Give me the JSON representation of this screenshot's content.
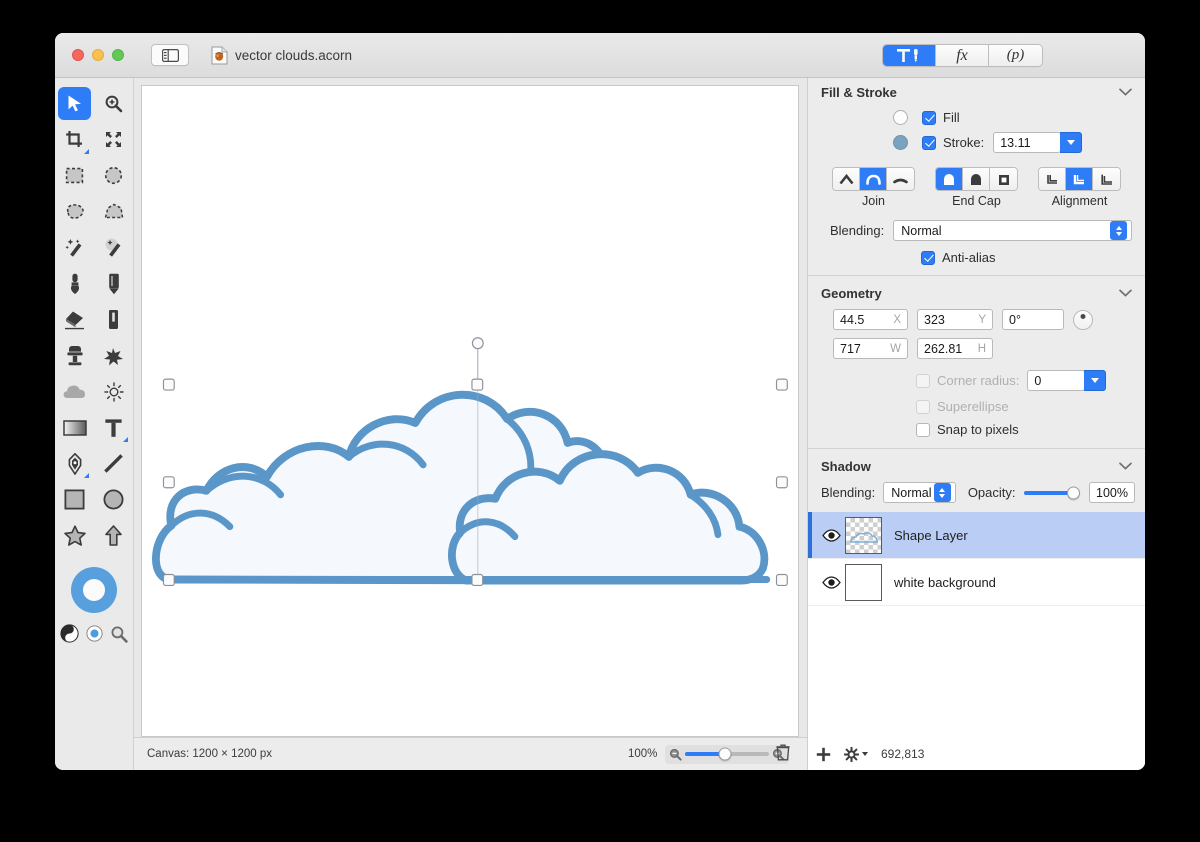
{
  "window": {
    "title": "vector clouds.acorn",
    "doc_icon": "acorn-document-icon",
    "sidebar_toggle_icon": "sidebar-toggle-icon"
  },
  "top_segmented": [
    {
      "id": "tools",
      "icon": "hammer-brush-icon",
      "label": "",
      "active": true
    },
    {
      "id": "filters",
      "label": "fx",
      "active": false
    },
    {
      "id": "presets",
      "label": "(p)",
      "active": false
    }
  ],
  "toolbar": {
    "tools": [
      {
        "name": "move-tool",
        "icon": "arrow-cursor-icon",
        "selected": true
      },
      {
        "name": "zoom-tool",
        "icon": "magnifier-plus-icon",
        "selected": false
      },
      {
        "name": "crop-tool",
        "icon": "crop-icon",
        "selected": false
      },
      {
        "name": "transform-tool",
        "icon": "transform-arrows-icon",
        "selected": false
      },
      {
        "name": "rectangular-select-tool",
        "icon": "marquee-rect-icon",
        "selected": false
      },
      {
        "name": "elliptical-select-tool",
        "icon": "marquee-ellipse-icon",
        "selected": false
      },
      {
        "name": "lasso-tool",
        "icon": "lasso-icon",
        "selected": false
      },
      {
        "name": "polygon-select-tool",
        "icon": "polygon-lasso-icon",
        "selected": false
      },
      {
        "name": "magic-wand-tool",
        "icon": "magic-wand-icon",
        "selected": false
      },
      {
        "name": "instant-alpha-tool",
        "icon": "magic-wand-dots-icon",
        "selected": false
      },
      {
        "name": "brush-tool",
        "icon": "paint-brush-icon",
        "selected": false
      },
      {
        "name": "pencil-tool",
        "icon": "pencil-icon",
        "selected": false
      },
      {
        "name": "eraser-tool",
        "icon": "eraser-icon",
        "selected": false
      },
      {
        "name": "marker-tool",
        "icon": "marker-icon",
        "selected": false
      },
      {
        "name": "clone-stamp-tool",
        "icon": "clone-stamp-icon",
        "selected": false
      },
      {
        "name": "smudge-tool",
        "icon": "smudge-splat-icon",
        "selected": false
      },
      {
        "name": "blur-tool",
        "icon": "cloud-blur-icon",
        "selected": false
      },
      {
        "name": "dodge-burn-tool",
        "icon": "sun-dodge-icon",
        "selected": false
      },
      {
        "name": "gradient-tool",
        "icon": "gradient-icon",
        "selected": false
      },
      {
        "name": "text-tool",
        "icon": "text-t-icon",
        "selected": false
      },
      {
        "name": "bezier-pen-tool",
        "icon": "pen-nib-icon",
        "selected": false
      },
      {
        "name": "line-tool",
        "icon": "line-icon",
        "selected": false
      },
      {
        "name": "rectangle-tool",
        "icon": "rectangle-icon",
        "selected": false
      },
      {
        "name": "ellipse-tool",
        "icon": "ellipse-icon",
        "selected": false
      },
      {
        "name": "star-tool",
        "icon": "star-icon",
        "selected": false
      },
      {
        "name": "arrow-shape-tool",
        "icon": "arrow-up-shape-icon",
        "selected": false
      }
    ],
    "color_well": {
      "name": "stroke-color-well",
      "color": "#57a0dd",
      "inner": "#fbfbfb"
    },
    "bottom_icons": [
      {
        "name": "default-colors-icon",
        "icon": "yin-yang-icon"
      },
      {
        "name": "color-picker-icon",
        "icon": "target-circle-icon"
      },
      {
        "name": "loupe-icon",
        "icon": "magnifier-icon"
      }
    ]
  },
  "inspector": {
    "fill_stroke": {
      "title": "Fill & Stroke",
      "collapse_icon": "chevron-down-icon",
      "fill": {
        "label": "Fill",
        "checked": true,
        "swatch_color": "#fdfdfd"
      },
      "stroke": {
        "label": "Stroke:",
        "checked": true,
        "swatch_color": "#7ba3bf",
        "width": "13.11"
      },
      "join": {
        "label": "Join",
        "options": [
          "miter-join-icon",
          "round-join-icon",
          "bevel-join-icon"
        ],
        "selected_index": 1
      },
      "end_cap": {
        "label": "End Cap",
        "options": [
          "round-cap-icon",
          "butt-cap-icon",
          "square-cap-icon"
        ],
        "selected_index": 0
      },
      "alignment": {
        "label": "Alignment",
        "options": [
          "align-inside-icon",
          "align-center-icon",
          "align-outside-icon"
        ],
        "selected_index": 1
      },
      "blending": {
        "label": "Blending:",
        "value": "Normal"
      },
      "anti_alias": {
        "label": "Anti-alias",
        "checked": true
      }
    },
    "geometry": {
      "title": "Geometry",
      "collapse_icon": "chevron-down-icon",
      "x": {
        "value": "44.5",
        "suffix": "X"
      },
      "y": {
        "value": "323",
        "suffix": "Y"
      },
      "rotation": {
        "value": "0°"
      },
      "w": {
        "value": "717",
        "suffix": "W"
      },
      "h": {
        "value": "262.81",
        "suffix": "H"
      },
      "corner_radius": {
        "label": "Corner radius:",
        "checked": false,
        "disabled": true,
        "value": "0"
      },
      "superellipse": {
        "label": "Superellipse",
        "checked": false,
        "disabled": true
      },
      "snap_to_pixels": {
        "label": "Snap to pixels",
        "checked": false,
        "disabled": false
      }
    },
    "shadow": {
      "title": "Shadow",
      "collapse_icon": "chevron-down-icon",
      "blending": {
        "label": "Blending:",
        "value": "Normal"
      },
      "opacity": {
        "label": "Opacity:",
        "value": "100%",
        "percent": 100
      }
    },
    "layers": [
      {
        "name": "Shape Layer",
        "selected": true,
        "visible": true,
        "thumb": "transparent-cloud-thumb"
      },
      {
        "name": "white background",
        "selected": false,
        "visible": true,
        "thumb": "white-thumb"
      }
    ]
  },
  "statusbar": {
    "canvas_info": "Canvas: 1200 × 1200 px",
    "zoom": "100%",
    "zoom_percent": 47,
    "zoom_out_icon": "magnifier-minus-icon",
    "zoom_in_icon": "magnifier-plus-icon",
    "add_layer_icon": "plus-icon",
    "layer_actions_icon": "gear-dropdown-icon",
    "cursor_position": "692,813",
    "delete_icon": "trash-icon"
  },
  "canvas": {
    "shape_name": "cloud-vector-shape",
    "stroke_color": "#5b96c9",
    "fill_color": "#f5f8fd",
    "selection_handles": 8
  }
}
